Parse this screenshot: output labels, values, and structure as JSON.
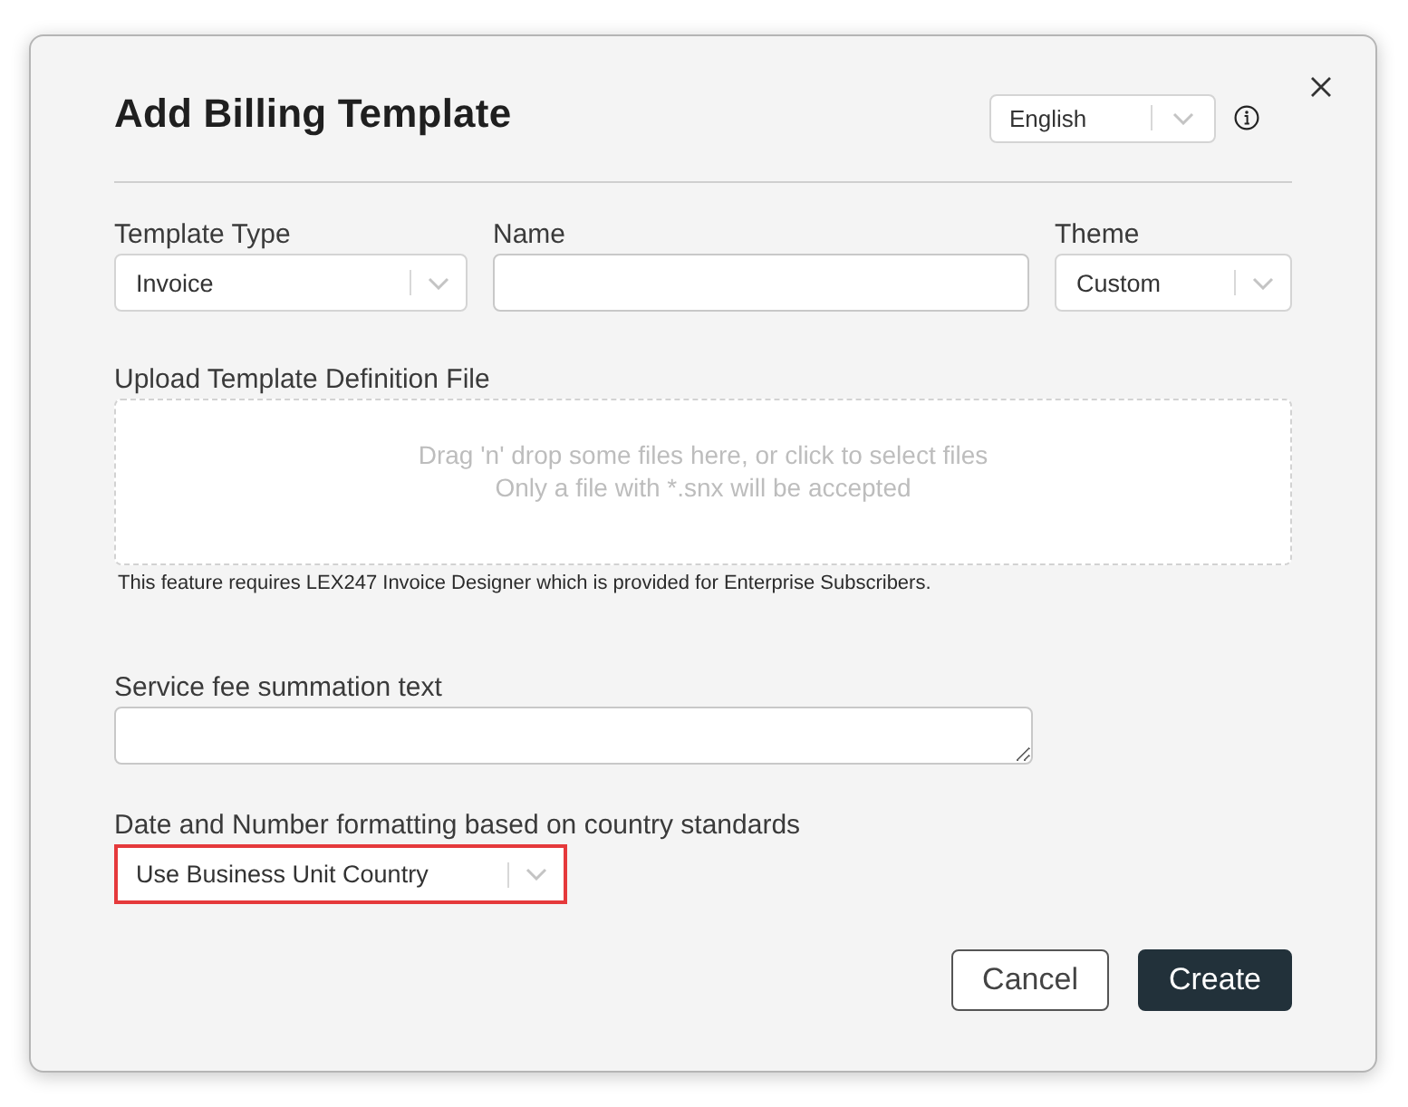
{
  "dialog": {
    "title": "Add Billing Template",
    "language_select": {
      "value": "English"
    },
    "fields": [
      {
        "kind": "select",
        "label": "Template Type",
        "value": "Invoice"
      },
      {
        "kind": "text",
        "label": "Name"
      },
      {
        "kind": "select",
        "label": "Theme",
        "value": "Custom"
      }
    ],
    "upload": {
      "label": "Upload Template Definition File",
      "instructions": "Drag 'n' drop some files here, or click to select files",
      "hint": "Only a file with *.snx will be accepted",
      "note": "This feature requires LEX247 Invoice Designer which is provided for Enterprise Subscribers."
    },
    "service_fee": {
      "label": "Service fee summation text"
    },
    "formatting": {
      "label": "Date and Number formatting based on country standards",
      "value": "Use Business Unit Country",
      "highlighted": true
    },
    "buttons": [
      {
        "kind": "secondary",
        "label": "Cancel"
      },
      {
        "kind": "primary",
        "label": "Create"
      }
    ]
  }
}
